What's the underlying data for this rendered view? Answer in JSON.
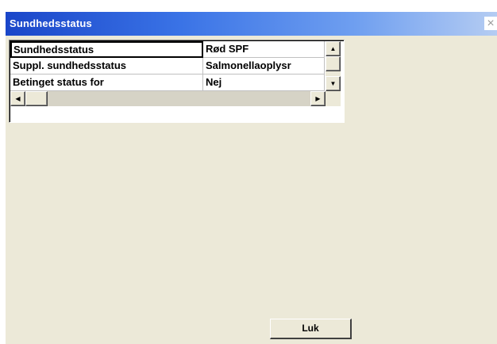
{
  "window": {
    "title": "Sundhedsstatus",
    "close_glyph": "×"
  },
  "grid": {
    "rows": [
      {
        "label": "Sundhedsstatus",
        "value": "Rød SPF"
      },
      {
        "label": "Suppl. sundhedsstatus",
        "value": "Salmonellaoplysr"
      },
      {
        "label": "Betinget status for",
        "value": "Nej"
      }
    ],
    "scroll_up_glyph": "▲",
    "scroll_down_glyph": "▼",
    "scroll_left_glyph": "◀",
    "scroll_right_glyph": "▶"
  },
  "footer": {
    "close_button_label": "Luk"
  },
  "colors": {
    "titlebar_start": "#1a46c9",
    "titlebar_end": "#b9cff3",
    "window_bg": "#ece9d8"
  }
}
